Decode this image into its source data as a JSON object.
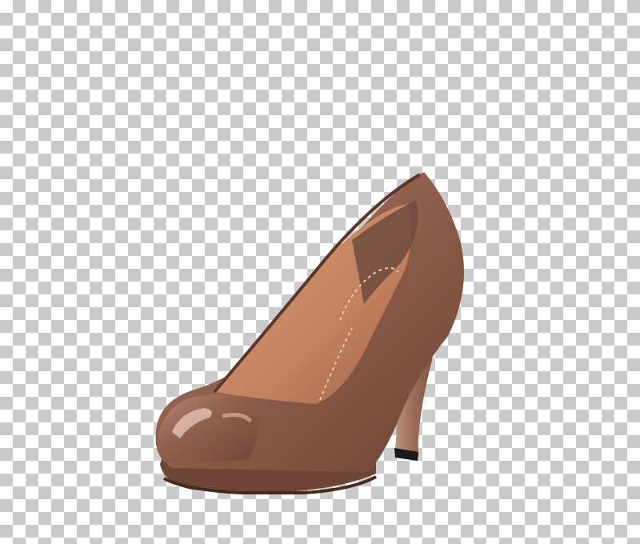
{
  "image": {
    "subject": "shoe-pump",
    "background": "transparency-checkerboard"
  },
  "colors": {
    "leather": "#8a5a48",
    "leather_dark": "#6e4535",
    "leather_light": "#a77462",
    "lining": "#c9896a",
    "lining_dark": "#9c6148",
    "sole_edge": "#5a3528",
    "heel_tip": "#1a1a1a",
    "checker_light": "#ffffff",
    "checker_dark": "#cccccc"
  }
}
